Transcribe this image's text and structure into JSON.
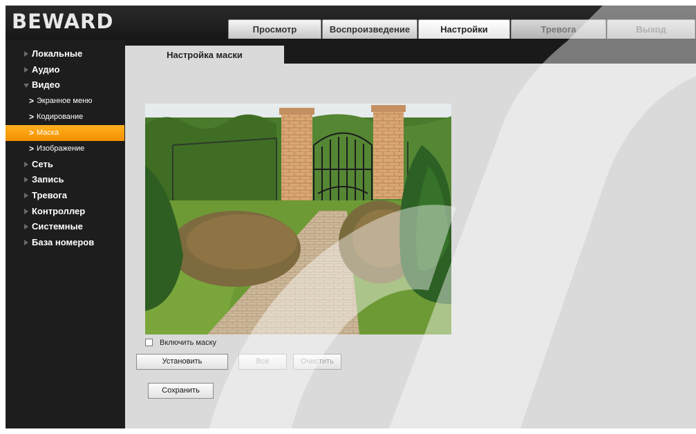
{
  "header": {
    "logo_text": "BEWARD",
    "tabs": [
      {
        "label": "Просмотр",
        "state": "normal"
      },
      {
        "label": "Воспроизведение",
        "state": "normal"
      },
      {
        "label": "Настройки",
        "state": "active"
      },
      {
        "label": "Тревога",
        "state": "inactive"
      },
      {
        "label": "Выход",
        "state": "inactive"
      }
    ]
  },
  "sidebar": {
    "items": [
      {
        "label": "Локальные"
      },
      {
        "label": "Аудио"
      },
      {
        "label": "Видео",
        "expanded": true
      },
      {
        "label": "Сеть"
      },
      {
        "label": "Запись"
      },
      {
        "label": "Тревога"
      },
      {
        "label": "Контроллер"
      },
      {
        "label": "Системные"
      },
      {
        "label": "База номеров"
      }
    ],
    "video_subitems": [
      {
        "label": "Экранное меню"
      },
      {
        "label": "Кодирование"
      },
      {
        "label": "Маска",
        "selected": true
      },
      {
        "label": "Изображение"
      }
    ]
  },
  "main": {
    "tab_title": "Настройка маски",
    "enable_mask_label": "Включить маску",
    "enable_mask_checked": false,
    "buttons": {
      "set": "Установить",
      "all": "Все",
      "clear": "Очистить",
      "save": "Сохранить"
    }
  },
  "colors": {
    "accent": "#f49000",
    "content_bg": "#dadada",
    "frame_bg": "#1a1a1a"
  }
}
